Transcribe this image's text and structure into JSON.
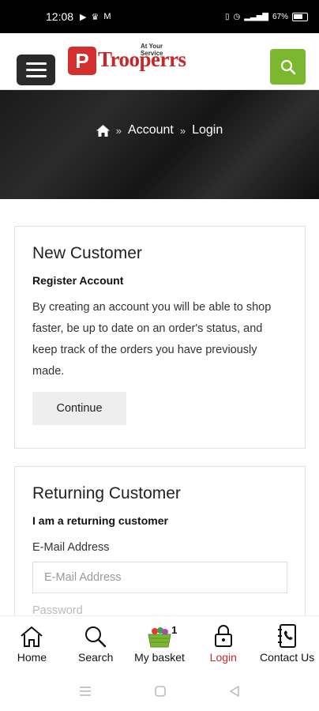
{
  "status_bar": {
    "time": "12:08",
    "battery": "67%"
  },
  "header": {
    "logo_letter": "P",
    "logo_text": "Trooperrs",
    "logo_tagline": "At Your Service"
  },
  "breadcrumb": {
    "home_icon": "home-icon",
    "items": [
      "Account",
      "Login"
    ],
    "separator": "»"
  },
  "new_customer": {
    "title": "New Customer",
    "subtitle": "Register Account",
    "description": "By creating an account you will be able to shop faster, be up to date on an order's status, and keep track of the orders you have previously made.",
    "continue_label": "Continue"
  },
  "returning_customer": {
    "title": "Returning Customer",
    "subtitle": "I am a returning customer",
    "email_label": "E-Mail Address",
    "email_placeholder": "E-Mail Address",
    "password_label": "Password"
  },
  "bottom_nav": {
    "home": "Home",
    "search": "Search",
    "basket": "My basket",
    "basket_count": "1",
    "login": "Login",
    "contact": "Contact Us"
  },
  "colors": {
    "accent_green": "#7cb82f",
    "brand_red": "#c62828",
    "active_nav": "#c62828"
  }
}
